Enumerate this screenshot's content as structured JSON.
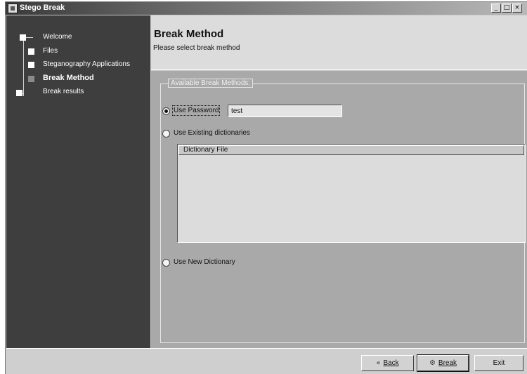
{
  "window": {
    "title": "Stego Break",
    "controls": {
      "minimize": "_",
      "maximize": "□",
      "close": "×"
    }
  },
  "sidebar": {
    "steps": [
      {
        "label": "Welcome",
        "active": false
      },
      {
        "label": "Files",
        "active": false
      },
      {
        "label": "Steganography Applications",
        "active": false
      },
      {
        "label": "Break Method",
        "active": true
      },
      {
        "label": "Break results",
        "active": false
      }
    ]
  },
  "header": {
    "title": "Break Method",
    "subtitle": "Please select break method"
  },
  "main": {
    "group_title": "Available Break Methods:",
    "options": {
      "use_password": {
        "label": "Use Password",
        "selected": true
      },
      "existing_dictionaries": {
        "label": "Use Existing dictionaries",
        "selected": false
      },
      "new_dictionary": {
        "label": "Use New Dictionary",
        "selected": false
      }
    },
    "password_value": "test",
    "dictionary_table": {
      "column_header": "Dictionary File",
      "rows": []
    }
  },
  "footer": {
    "back": {
      "label": "Back",
      "icon": "back-arrow-icon"
    },
    "break": {
      "label": "Break",
      "icon": "break-icon"
    },
    "exit": {
      "label": "Exit"
    }
  }
}
